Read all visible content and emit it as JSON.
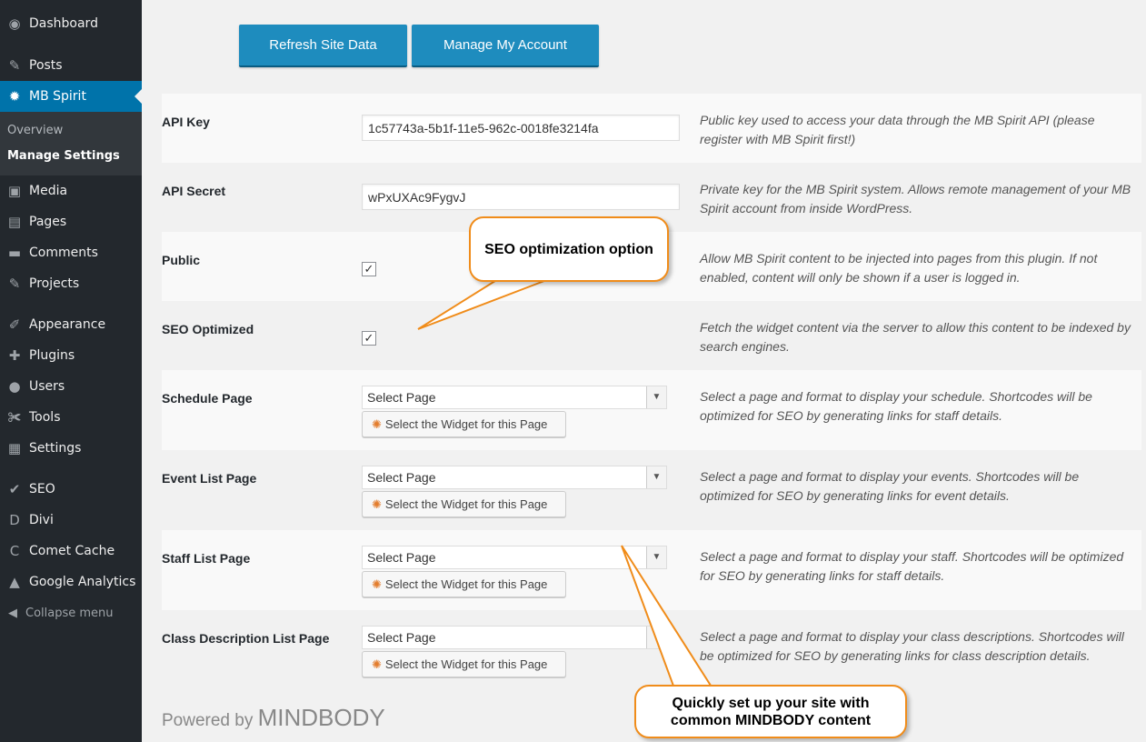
{
  "sidebar": {
    "items": [
      {
        "label": "Dashboard",
        "icon": "dashboard-icon",
        "glyph": "◉"
      },
      {
        "label": "Posts",
        "icon": "pin-icon",
        "glyph": "✎"
      },
      {
        "label": "MB Spirit",
        "icon": "gear-icon",
        "glyph": "✹"
      },
      {
        "label": "Media",
        "icon": "media-icon",
        "glyph": "▣"
      },
      {
        "label": "Pages",
        "icon": "pages-icon",
        "glyph": "▤"
      },
      {
        "label": "Comments",
        "icon": "comment-icon",
        "glyph": "▬"
      },
      {
        "label": "Projects",
        "icon": "pin-icon",
        "glyph": "✎"
      },
      {
        "label": "Appearance",
        "icon": "brush-icon",
        "glyph": "✐"
      },
      {
        "label": "Plugins",
        "icon": "plug-icon",
        "glyph": "✚"
      },
      {
        "label": "Users",
        "icon": "user-icon",
        "glyph": "●"
      },
      {
        "label": "Tools",
        "icon": "wrench-icon",
        "glyph": "✀"
      },
      {
        "label": "Settings",
        "icon": "settings-icon",
        "glyph": "▦"
      },
      {
        "label": "SEO",
        "icon": "seo-icon",
        "glyph": "✔"
      },
      {
        "label": "Divi",
        "icon": "divi-icon",
        "glyph": "D"
      },
      {
        "label": "Comet Cache",
        "icon": "comet-icon",
        "glyph": "C"
      },
      {
        "label": "Google Analytics",
        "icon": "analytics-icon",
        "glyph": "▲"
      }
    ],
    "submenu": [
      "Overview",
      "Manage Settings"
    ],
    "collapse_label": "Collapse menu"
  },
  "toolbar": {
    "refresh_label": "Refresh Site Data",
    "manage_label": "Manage My Account"
  },
  "settings": {
    "api_key": {
      "label": "API Key",
      "value": "1c57743a-5b1f-11e5-962c-0018fe3214fa",
      "description": "Public key used to access your data through the MB Spirit API (please register with MB Spirit first!)"
    },
    "api_secret": {
      "label": "API Secret",
      "value": "wPxUXAc9FygvJ",
      "description": "Private key for the MB Spirit system. Allows remote management of your MB Spirit account from inside WordPress."
    },
    "public": {
      "label": "Public",
      "checked": true,
      "description": "Allow MB Spirit content to be injected into pages from this plugin. If not enabled, content will only be shown if a user is logged in."
    },
    "seo_optimized": {
      "label": "SEO Optimized",
      "checked": true,
      "description": "Fetch the widget content via the server to allow this content to be indexed by search engines."
    },
    "schedule_page": {
      "label": "Schedule Page",
      "select": "Select Page",
      "widget_button": "Select the Widget for this Page",
      "description": "Select a page and format to display your schedule. Shortcodes will be optimized for SEO by generating links for staff details."
    },
    "event_list_page": {
      "label": "Event List Page",
      "select": "Select Page",
      "widget_button": "Select the Widget for this Page",
      "description": "Select a page and format to display your events. Shortcodes will be optimized for SEO by generating links for event details."
    },
    "staff_list_page": {
      "label": "Staff List Page",
      "select": "Select Page",
      "widget_button": "Select the Widget for this Page",
      "description": "Select a page and format to display your staff. Shortcodes will be optimized for SEO by generating links for staff details."
    },
    "class_description_list_page": {
      "label": "Class Description List Page",
      "select": "Select Page",
      "widget_button": "Select the Widget for this Page",
      "description": "Select a page and format to display your class descriptions. Shortcodes will be optimized for SEO by generating links for class description details."
    }
  },
  "footer": {
    "powered_by": "Powered by",
    "brand": "MINDBODY"
  },
  "callouts": {
    "seo": "SEO optimization option",
    "setup": "Quickly set up your site with common MINDBODY content"
  },
  "colors": {
    "sidebar_bg": "#23282d",
    "active": "#0073aa",
    "button": "#1e8cbe",
    "callout_border": "#f08c1a"
  }
}
